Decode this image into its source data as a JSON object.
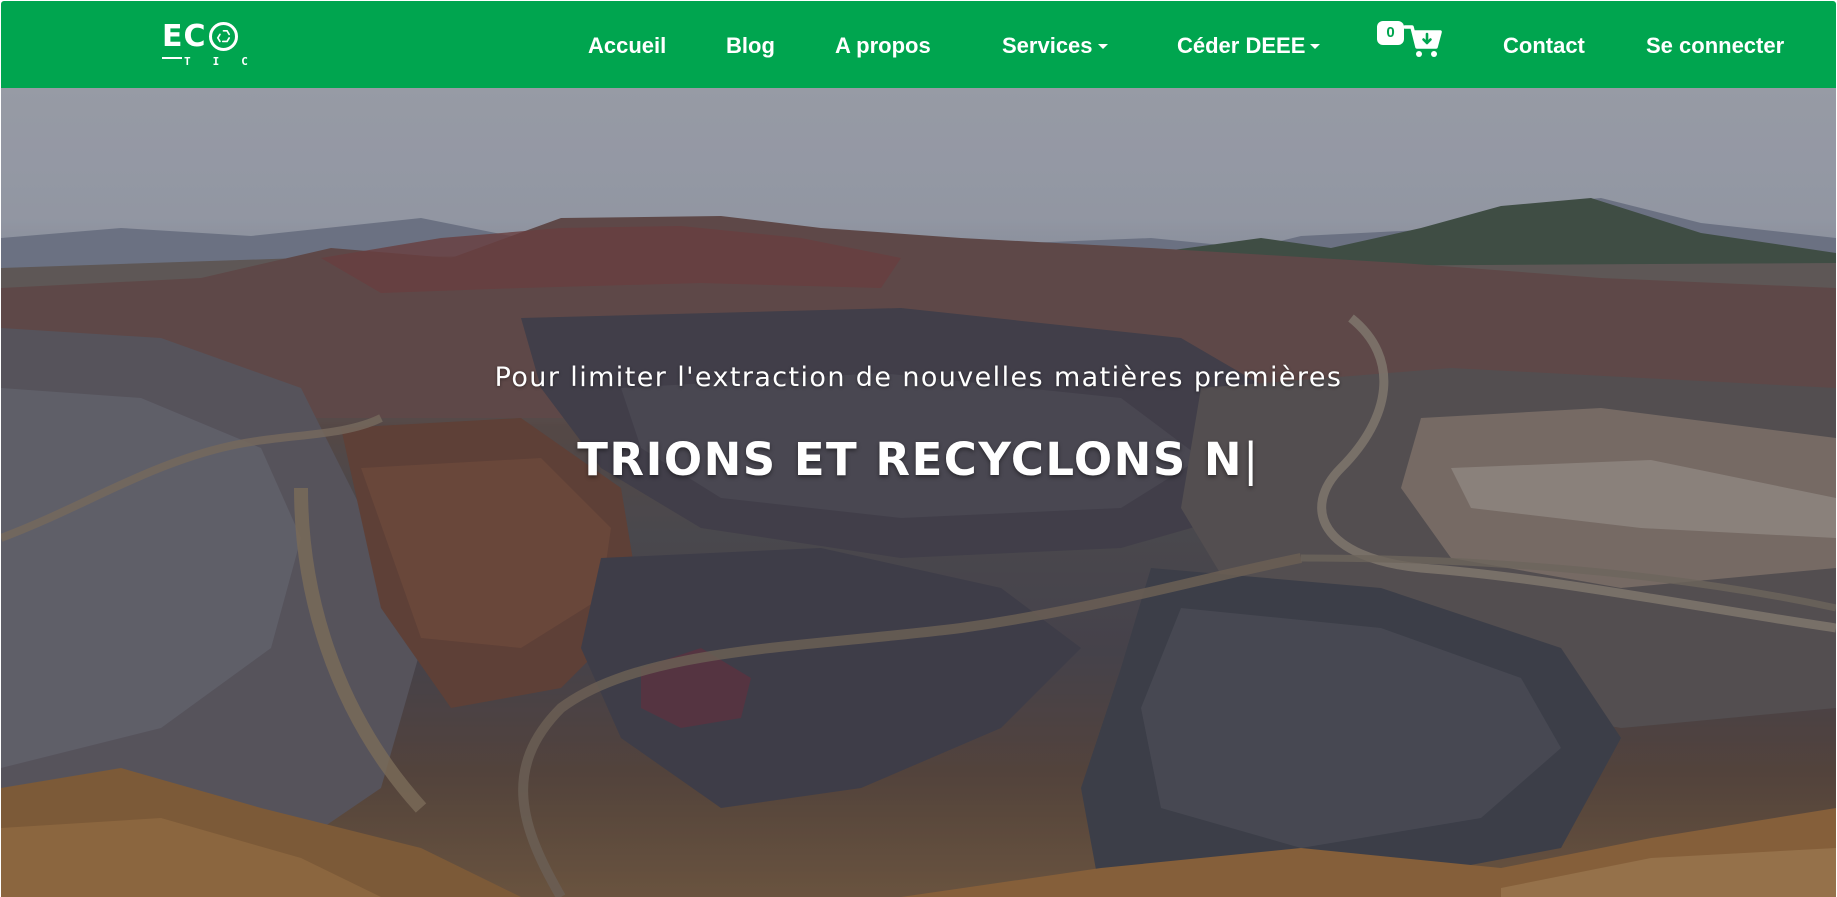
{
  "brand": {
    "logo_top": "EC",
    "logo_bottom": "TIC",
    "name": "ECO TIC"
  },
  "nav": {
    "items": [
      {
        "label": "Accueil"
      },
      {
        "label": "Blog"
      },
      {
        "label": "A propos"
      },
      {
        "label": "Services",
        "dropdown": true
      },
      {
        "label": "Céder DEEE",
        "dropdown": true
      },
      {
        "label": "Contact"
      },
      {
        "label": "Se connecter"
      }
    ],
    "cart_count": "0"
  },
  "hero": {
    "subtitle": "Pour limiter l'extraction de nouvelles matières premières",
    "title": "TRIONS ET RECYCLONS N",
    "cursor": "|"
  },
  "colors": {
    "brand_green": "#00a54f",
    "text_white": "#ffffff"
  },
  "icons": {
    "cart": "cart-download-icon",
    "logo_o": "recycle-icon",
    "dropdown": "caret-down-icon"
  }
}
